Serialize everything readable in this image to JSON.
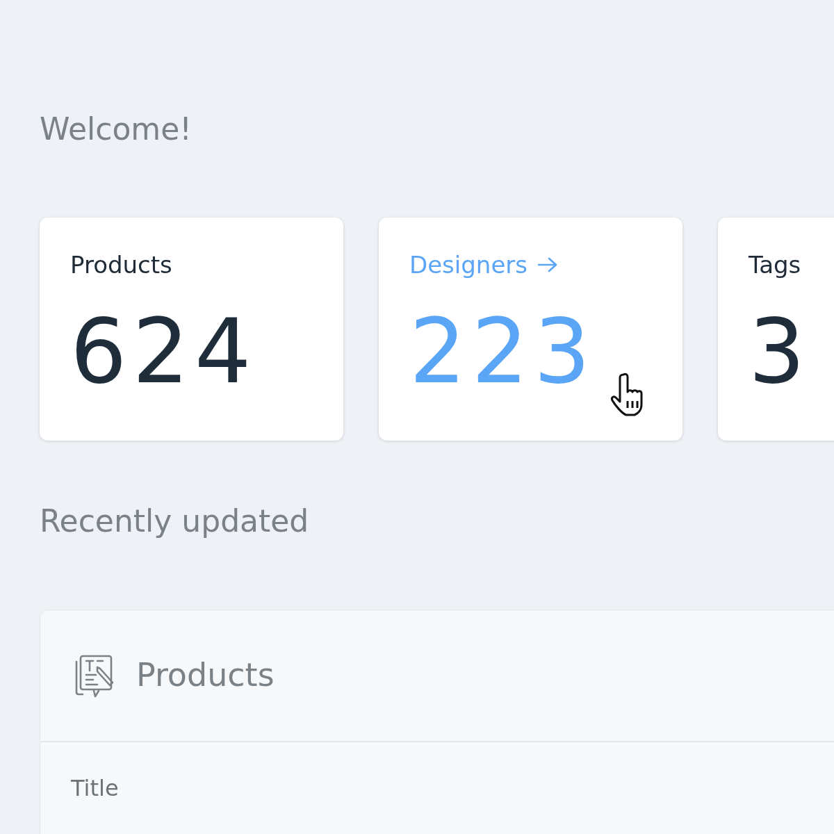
{
  "heading": "Welcome!",
  "stats": [
    {
      "label": "Products",
      "value": "624",
      "link": false
    },
    {
      "label": "Designers",
      "value": "223",
      "link": true
    },
    {
      "label": "Tags",
      "value": "3",
      "link": false
    }
  ],
  "section_title": "Recently updated",
  "panel": {
    "title": "Products",
    "columns": [
      "Title"
    ]
  }
}
